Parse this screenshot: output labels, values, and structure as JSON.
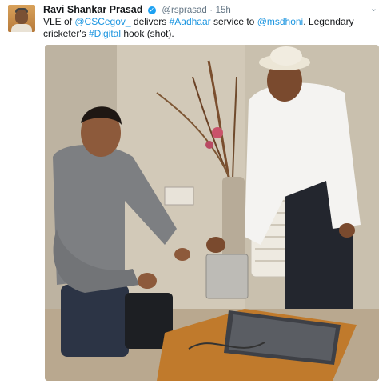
{
  "tweet": {
    "author_name": "Ravi Shankar Prasad",
    "handle": "@rsprasad",
    "separator": "·",
    "time": "15h",
    "caret": "⌄",
    "text": {
      "t1": "VLE of ",
      "m1": "@CSCegov_",
      "t2": " delivers ",
      "h1": "#Aadhaar",
      "t3": " service to ",
      "m2": "@msdhoni",
      "t4": ". Legendary cricketer's ",
      "h2": "#Digital",
      "t5": " hook (shot)."
    }
  },
  "colors": {
    "link": "#1b95e0",
    "verified": "#1da1f2",
    "secondary_text": "#657786"
  },
  "icons": {
    "verified": "verified-badge-icon",
    "menu": "chevron-down-icon"
  }
}
